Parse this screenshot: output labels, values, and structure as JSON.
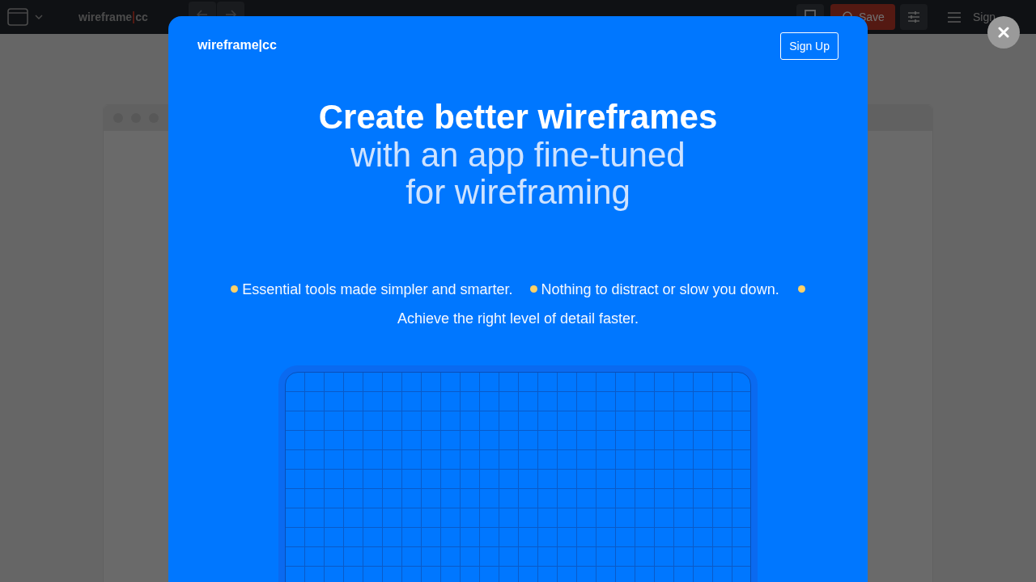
{
  "app_bar": {
    "logo_left": "wireframe",
    "logo_right": "cc",
    "save_button": "Save",
    "sign_up": "Sign"
  },
  "modal": {
    "logo": "wireframe|cc",
    "sign_up_button": "Sign Up",
    "headline": "Create better wireframes",
    "subtitle_lines": [
      "with an app fine-tuned",
      "for wireframing"
    ],
    "features": [
      "Essential tools made simpler and smarter.",
      "Nothing to distract or slow you down.",
      "Achieve the right level of detail faster."
    ]
  }
}
